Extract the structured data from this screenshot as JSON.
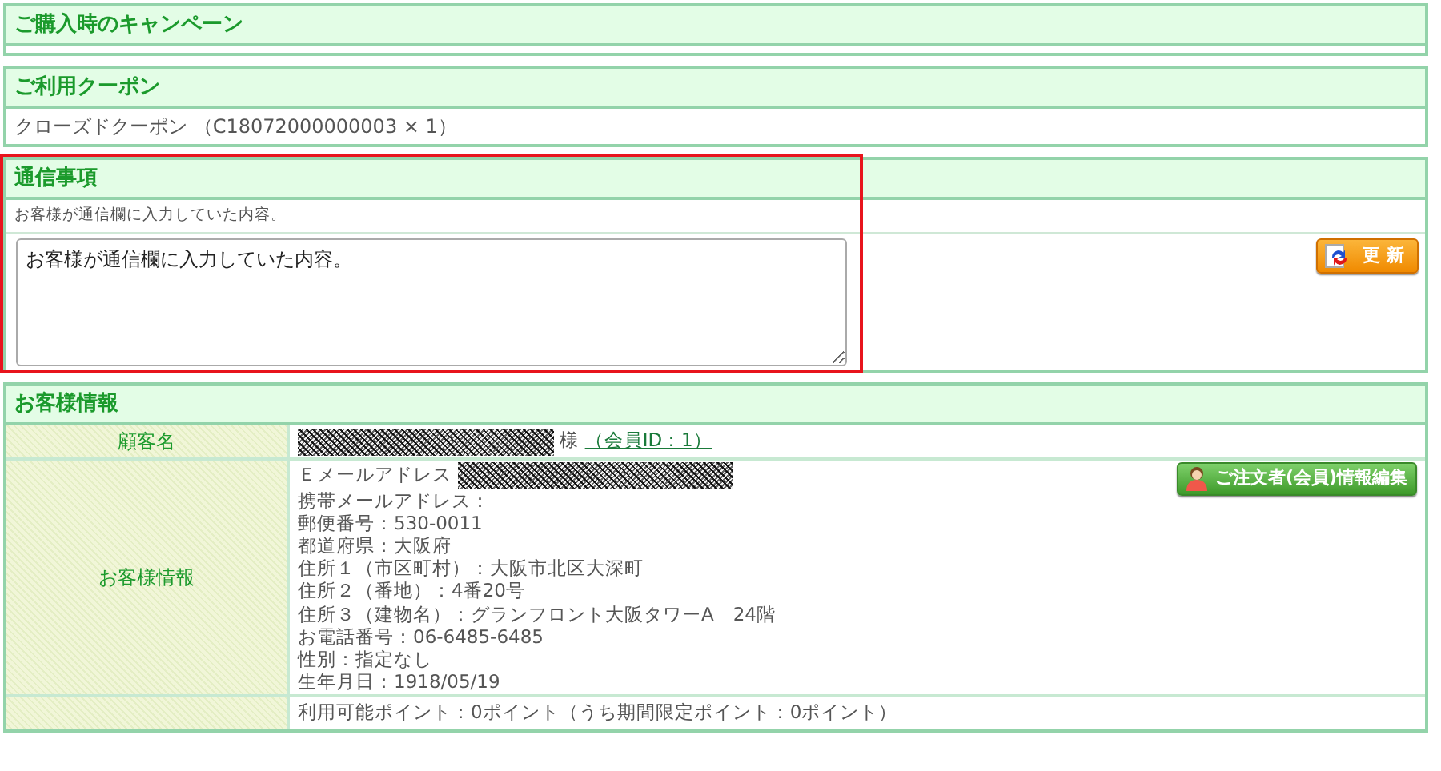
{
  "sections": [
    {
      "kind": "empty",
      "title": "ご購入時のキャンペーン"
    },
    {
      "kind": "text",
      "title": "ご利用クーポン",
      "text": "クローズドクーポン （C18072000000003 × 1）"
    },
    {
      "kind": "message",
      "title": "通信事項",
      "highlighted": true,
      "note": "お客様が通信欄に入力していた内容。",
      "value": "お客様が通信欄に入力していた内容。",
      "button": "更 新"
    },
    {
      "kind": "table",
      "title": "お客様情報",
      "rows": [
        {
          "kind": "name",
          "label": "顧客名",
          "redacted": true,
          "suffix": "様",
          "link": "（会員ID：1）"
        },
        {
          "kind": "info",
          "label": "お客様情報",
          "email_label": "Ｅメールアドレス",
          "email_redacted": true,
          "lines": [
            "携帯メールアドレス：",
            "郵便番号：530-0011",
            "都道府県：大阪府",
            "住所１（市区町村）：大阪市北区大深町",
            "住所２（番地）：4番20号",
            "住所３（建物名）：グランフロント大阪タワーA　24階",
            "お電話番号：06-6485-6485",
            "性別：指定なし",
            "生年月日：1918/05/19"
          ],
          "button": "ご注文者(会員)情報編集"
        },
        {
          "kind": "plain",
          "label": "",
          "text": "利用可能ポイント：0ポイント（うち期間限定ポイント：0ポイント）"
        }
      ]
    }
  ]
}
